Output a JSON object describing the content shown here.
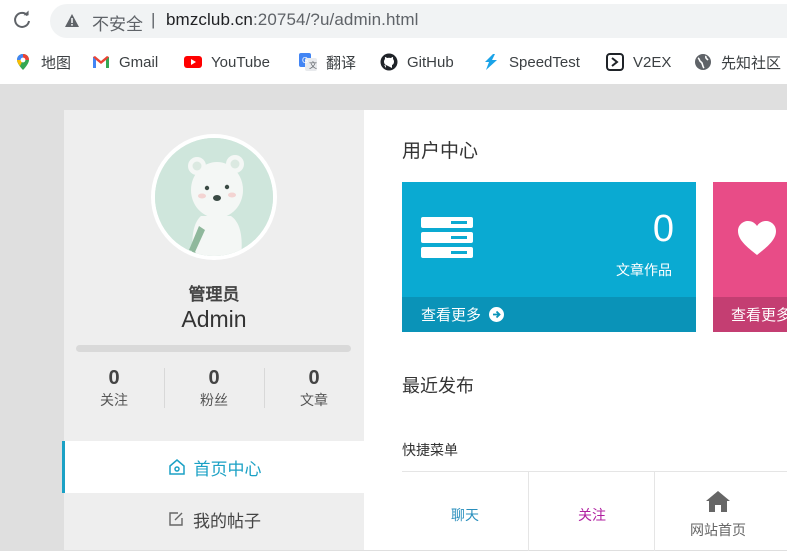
{
  "browser": {
    "insecure_label": "不安全",
    "separator": "|",
    "url_host": "bmzclub.cn",
    "url_rest": ":20754/?u/admin.html",
    "bookmarks": [
      {
        "label": "地图",
        "icon": "maps-pin-icon"
      },
      {
        "label": "Gmail",
        "icon": "gmail-icon"
      },
      {
        "label": "YouTube",
        "icon": "youtube-icon"
      },
      {
        "label": "翻译",
        "icon": "translate-icon"
      },
      {
        "label": "GitHub",
        "icon": "github-icon"
      },
      {
        "label": "SpeedTest",
        "icon": "speedtest-icon"
      },
      {
        "label": "V2EX",
        "icon": "v2ex-icon"
      },
      {
        "label": "先知社区",
        "icon": "globe-icon"
      }
    ]
  },
  "profile": {
    "role": "管理员",
    "name": "Admin",
    "stats": [
      {
        "value": "0",
        "label": "关注"
      },
      {
        "value": "0",
        "label": "粉丝"
      },
      {
        "value": "0",
        "label": "文章"
      }
    ]
  },
  "sidebar": {
    "items": [
      {
        "label": "首页中心",
        "icon": "home-icon",
        "active": true
      },
      {
        "label": "我的帖子",
        "icon": "edit-icon",
        "active": false
      }
    ]
  },
  "main": {
    "title": "用户中心",
    "cards": [
      {
        "value": "0",
        "caption": "文章作品",
        "more": "查看更多",
        "color": "#0aaad2"
      },
      {
        "more": "查看更多",
        "color": "#e84c87"
      }
    ],
    "recent_title": "最近发布",
    "quick_title": "快捷菜单",
    "quick_items": [
      {
        "label": "聊天",
        "color": "#2a8fbd"
      },
      {
        "label": "关注",
        "color": "#b01fa0"
      },
      {
        "label": "网站首页",
        "color": "#666666",
        "icon": "home-icon"
      }
    ]
  }
}
